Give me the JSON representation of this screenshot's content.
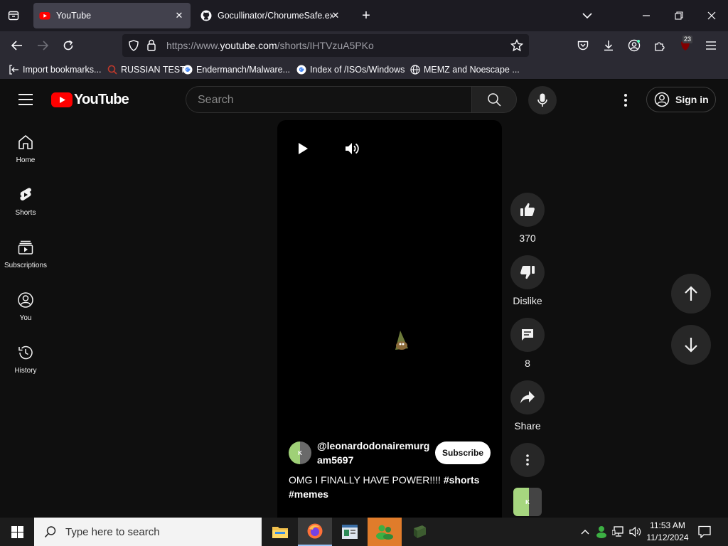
{
  "browser": {
    "tabs": [
      {
        "title": "YouTube",
        "icon": "youtube-favicon",
        "active": true
      },
      {
        "title": "Gocullinator/ChorumeSafe.exe",
        "icon": "github-icon",
        "active": false
      }
    ],
    "url_prefix": "https://www.",
    "url_domain": "youtube.com",
    "url_path": "/shorts/IHTVzuA5PKo",
    "extension_badge": "23",
    "bookmarks": [
      {
        "label": "Import bookmarks...",
        "icon": "import-icon"
      },
      {
        "label": "RUSSIAN TEST",
        "icon": "search-favicon"
      },
      {
        "label": "Endermanch/Malware...",
        "icon": "google-favicon"
      },
      {
        "label": "Index of /ISOs/Windows",
        "icon": "google-favicon"
      },
      {
        "label": "MEMZ and Noescape ...",
        "icon": "globe-icon"
      }
    ]
  },
  "youtube": {
    "logo_text": "YouTube",
    "search_placeholder": "Search",
    "sign_in": "Sign in",
    "sidebar": [
      {
        "label": "Home",
        "icon": "home-icon"
      },
      {
        "label": "Shorts",
        "icon": "shorts-icon"
      },
      {
        "label": "Subscriptions",
        "icon": "subscriptions-icon"
      },
      {
        "label": "You",
        "icon": "you-icon"
      },
      {
        "label": "History",
        "icon": "history-icon"
      }
    ],
    "short": {
      "channel": "@leonardodonairemurgam5697",
      "subscribe": "Subscribe",
      "caption_text": "OMG I FINALLY HAVE POWER!!!! ",
      "hashtags": [
        "#shorts",
        "#memes"
      ]
    },
    "actions": {
      "likes": "370",
      "dislike": "Dislike",
      "comments": "8",
      "share": "Share"
    },
    "colors": {
      "brand_red": "#ff0000",
      "background": "#0f0f0f"
    }
  },
  "taskbar": {
    "search_placeholder": "Type here to search",
    "time": "11:53 AM",
    "date": "11/12/2024"
  }
}
